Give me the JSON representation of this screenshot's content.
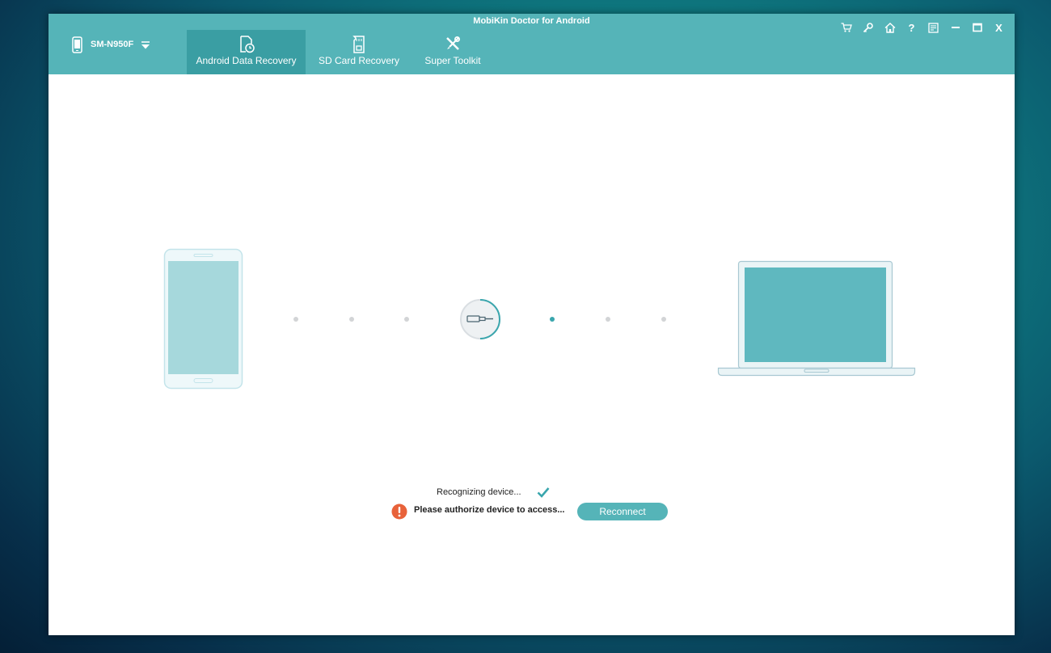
{
  "window": {
    "title": "MobiKin Doctor for Android"
  },
  "device": {
    "name": "SM-N950F",
    "icon": "phone-icon"
  },
  "tabs": [
    {
      "label": "Android Data Recovery",
      "icon": "document-restore-icon",
      "active": true
    },
    {
      "label": "SD Card Recovery",
      "icon": "sd-card-icon",
      "active": false
    },
    {
      "label": "Super Toolkit",
      "icon": "tools-icon",
      "active": false
    }
  ],
  "controls": {
    "cart": "cart-icon",
    "key": "key-icon",
    "home": "home-icon",
    "help": "?",
    "feedback": "feedback-icon",
    "minimize": "minimize-icon",
    "maximize": "maximize-icon",
    "close": "X"
  },
  "connection": {
    "progress_dots": 6,
    "active_dot": 4,
    "cable_icon": "usb-cable-icon"
  },
  "status": {
    "recognizing": "Recognizing device...",
    "recognizing_done": true,
    "authorize": "Please authorize device to access...",
    "reconnect_label": "Reconnect"
  },
  "colors": {
    "header": "#55b4b8",
    "active_tab": "#3a9ea3",
    "accent": "#3aa6ad",
    "warning": "#e8623a"
  }
}
